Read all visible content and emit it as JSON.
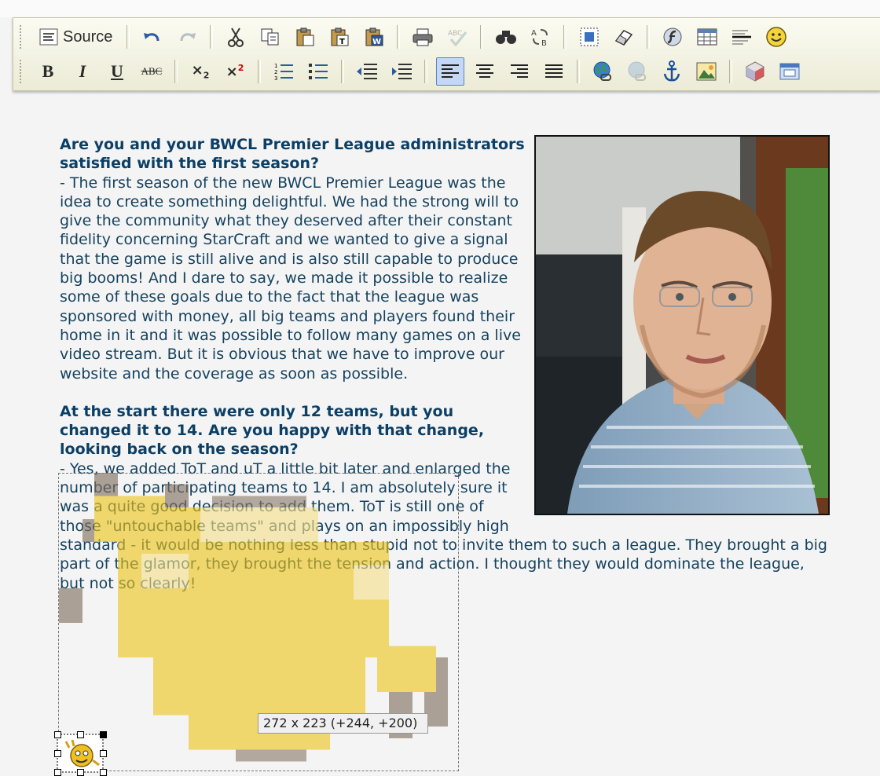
{
  "toolbar": {
    "source_label": "Source",
    "row1": [
      "source-icon",
      "undo-icon",
      "redo-icon",
      "cut-icon",
      "copy-icon",
      "paste-icon",
      "paste-text-icon",
      "paste-word-icon",
      "print-icon",
      "spellcheck-icon",
      "find-icon",
      "replace-icon",
      "select-all-icon",
      "remove-format-icon",
      "flash-icon",
      "table-icon",
      "horizontal-rule-icon",
      "smiley-icon"
    ],
    "row2": [
      "bold-icon",
      "italic-icon",
      "underline-icon",
      "strikethrough-icon",
      "subscript-icon",
      "superscript-icon",
      "numbered-list-icon",
      "bulleted-list-icon",
      "decrease-indent-icon",
      "increase-indent-icon",
      "align-left-icon",
      "align-center-icon",
      "align-right-icon",
      "justify-icon",
      "link-icon",
      "unlink-icon",
      "anchor-icon",
      "image-icon",
      "plugin-icon",
      "maximize-icon"
    ],
    "active_button": "align-left-icon",
    "disabled_buttons": [
      "redo-icon",
      "unlink-icon"
    ],
    "accent": "#5b84c4"
  },
  "article": {
    "q1": "Are you and your BWCL Premier League administrators satisfied with the first season?",
    "a1": "- The first season of the new BWCL Premier League was the idea to create something delightful. We had the strong will to give the community what they deserved after their constant fidelity concerning StarCraft and we wanted to give a signal that the game is still alive and is also still capable to produce big booms! And I dare to say, we made it possible to realize some of these goals due to the fact that the league was sponsored with money, all big teams and players found their home in it and it was possible to follow many games on a live video stream. But it is obvious that we have to improve our website and the coverage as soon as possible.",
    "q2": "At the start there were only 12 teams, but you changed it to 14. Are you happy with that change, looking back on the season?",
    "a2": "- Yes, we added ToT and uT a little bit later and enlarged the number of participating teams to 14. I am absolutely sure it was a quite good decision to add them. ToT is still one of those \"untouchable teams\" and plays on an impossibly high standard - it would be nothing less than stupid not to invite them to such a league. They brought a big part of the glamor, they brought the tension and action. I thought they would dominate the league, but not so clearly!",
    "text_color": "#15425f"
  },
  "resize_tooltip": "272 x 223 (+244, +200)"
}
